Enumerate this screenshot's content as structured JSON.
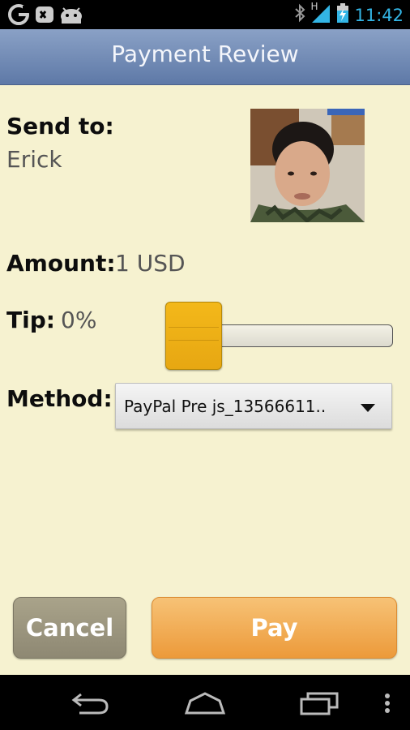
{
  "status_bar": {
    "time": "11:42",
    "time_color": "#33b5e5",
    "network_label": "H",
    "left_icons": [
      "google-icon",
      "game-controller-icon",
      "android-icon"
    ],
    "right_icons": [
      "bluetooth-icon",
      "signal-icon",
      "battery-charging-icon"
    ]
  },
  "header": {
    "title": "Payment Review"
  },
  "send_to": {
    "label": "Send to:",
    "value": "Erick"
  },
  "amount": {
    "label": "Amount:",
    "value": "1 USD"
  },
  "tip": {
    "label": "Tip:",
    "value": "0%",
    "slider_level": 0
  },
  "method": {
    "label": "Method:",
    "selected": "PayPal Pre js_13566611.."
  },
  "actions": {
    "cancel_label": "Cancel",
    "pay_label": "Pay"
  },
  "nav": {
    "icons": [
      "back-icon",
      "home-icon",
      "recent-apps-icon",
      "overflow-menu-icon"
    ]
  },
  "colors": {
    "background": "#f6f2d0",
    "header": "#6f88b3",
    "slider_thumb": "#f0b017",
    "pay_button": "#f0a245",
    "cancel_button": "#9c977f"
  }
}
